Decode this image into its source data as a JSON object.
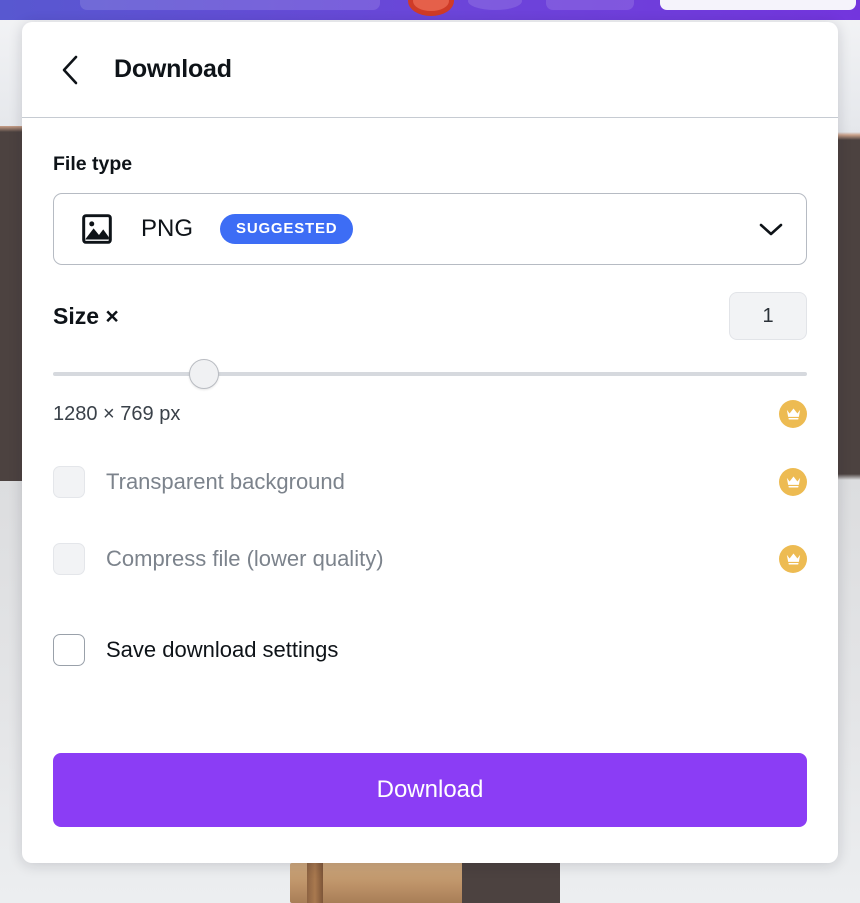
{
  "editor": {
    "toolbar": {
      "background_color": "#6c44d9",
      "avatar_color": "#cf3b27"
    },
    "canvas": {
      "photo_description": "interior-photo"
    }
  },
  "panel": {
    "header": {
      "back_icon": "chevron-left-icon",
      "title": "Download"
    },
    "file_type": {
      "section_label": "File type",
      "icon": "image-icon",
      "value": "PNG",
      "badge": "SUGGESTED",
      "badge_color": "#3d6df5",
      "chevron_icon": "chevron-down-icon"
    },
    "size": {
      "label": "Size ×",
      "value": "1",
      "slider_percent": 20,
      "dimensions": "1280 × 769 px",
      "pro_icon": "crown-icon"
    },
    "options": [
      {
        "id": "transparent-background",
        "label": "Transparent background",
        "checked": false,
        "disabled": true,
        "pro_icon": "crown-icon"
      },
      {
        "id": "compress-file",
        "label": "Compress file (lower quality)",
        "checked": false,
        "disabled": true,
        "pro_icon": "crown-icon"
      },
      {
        "id": "save-download-settings",
        "label": "Save download settings",
        "checked": false,
        "disabled": false,
        "pro_icon": null
      }
    ],
    "primary_action": {
      "label": "Download",
      "color": "#8b3df5"
    }
  }
}
